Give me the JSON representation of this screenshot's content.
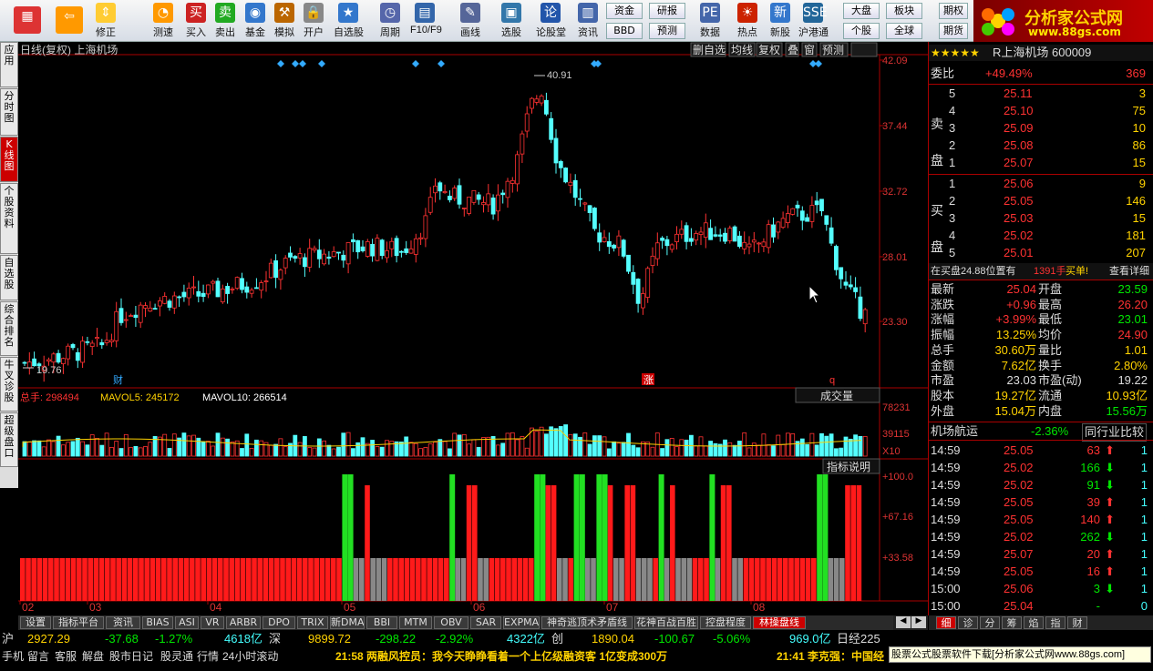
{
  "toolbar": {
    "buttons": [
      {
        "label": "",
        "icon": "windows-logo-icon"
      },
      {
        "label": "",
        "icon": "back-arrow-icon"
      },
      {
        "label": "修正",
        "icon": "up-down-arrow-icon"
      },
      {
        "label": "测速",
        "icon": "clock-icon"
      },
      {
        "label": "买入",
        "icon": "buy-icon"
      },
      {
        "label": "卖出",
        "icon": "sell-icon"
      },
      {
        "label": "基金",
        "icon": "fund-icon"
      },
      {
        "label": "模拟",
        "icon": "hammer-icon"
      },
      {
        "label": "开户",
        "icon": "lock-icon"
      },
      {
        "label": "自选股",
        "icon": "star-icon"
      },
      {
        "label": "周期",
        "icon": "clock-dropdown-icon"
      },
      {
        "label": "F10/F9",
        "icon": "doc-icon"
      },
      {
        "label": "画线",
        "icon": "pen-icon"
      },
      {
        "label": "选股",
        "icon": "screen-icon"
      },
      {
        "label": "论股堂",
        "icon": "forum-icon"
      },
      {
        "label": "资讯",
        "icon": "news-icon"
      },
      {
        "label": "数据",
        "icon": "pe-icon"
      },
      {
        "label": "热点",
        "icon": "hot-icon"
      },
      {
        "label": "新股",
        "icon": "ipo-icon"
      },
      {
        "label": "沪港通",
        "icon": "hk-icon"
      }
    ],
    "small": {
      "fund": "资金",
      "research": "研报",
      "bbd": "BBD",
      "forecast": "预测",
      "market": "大盘",
      "sector": "板块",
      "futures": "期权",
      "stock": "个股",
      "global": "全球",
      "fut": "期货"
    }
  },
  "logo": {
    "title": "分析家公式网",
    "url": "www.88gs.com"
  },
  "sidebar": {
    "tabs": [
      "应用",
      "分时图",
      "K线图",
      "个股资料",
      "自选股",
      "综合排名",
      "牛叉诊股",
      "超级盘口"
    ]
  },
  "chart": {
    "title": "日线(复权) 上海机场",
    "toolbar": [
      "删自选",
      "均线",
      "复权",
      "叠",
      "窗",
      "预测"
    ],
    "price_axis": [
      "42.09",
      "37.44",
      "32.72",
      "28.01",
      "23.30"
    ],
    "high_label": "40.91",
    "low_label": "19.76",
    "markers": [
      "财",
      "涨",
      "q"
    ],
    "vol_legend": {
      "total": "总手: 298494",
      "mavol5": "MAVOL5: 245172",
      "mavol10": "MAVOL10: 266514",
      "select": "成交量"
    },
    "vol_axis": [
      "78231",
      "39115",
      "X10"
    ],
    "ind_button": "指标说明",
    "ind_axis": [
      "+100.0",
      "+67.16",
      "+33.58"
    ],
    "months": [
      "02",
      "03",
      "04",
      "05",
      "06",
      "07",
      "08"
    ]
  },
  "chart_data": {
    "type": "candlestick",
    "high": 40.91,
    "low": 19.76,
    "y_range": [
      19.0,
      42.09
    ],
    "volume_max": 78231
  },
  "quote": {
    "title": "R上海机场 600009",
    "weibi": {
      "label": "委比",
      "value": "+49.49%",
      "diff": "369"
    },
    "sell_label": "卖盘",
    "buy_label": "买盘",
    "asks": [
      {
        "n": "5",
        "p": "25.11",
        "v": "3"
      },
      {
        "n": "4",
        "p": "25.10",
        "v": "75"
      },
      {
        "n": "3",
        "p": "25.09",
        "v": "10"
      },
      {
        "n": "2",
        "p": "25.08",
        "v": "86"
      },
      {
        "n": "1",
        "p": "25.07",
        "v": "15"
      }
    ],
    "bids": [
      {
        "n": "1",
        "p": "25.06",
        "v": "9"
      },
      {
        "n": "2",
        "p": "25.05",
        "v": "146"
      },
      {
        "n": "3",
        "p": "25.03",
        "v": "15"
      },
      {
        "n": "4",
        "p": "25.02",
        "v": "181"
      },
      {
        "n": "5",
        "p": "25.01",
        "v": "207"
      }
    ],
    "notice": {
      "a": "在买盘24.88位置有",
      "b": "1391手",
      "c": "买单!",
      "d": "查看详细"
    },
    "stats": [
      {
        "l": "最新",
        "v": "25.04",
        "l2": "开盘",
        "v2": "23.59"
      },
      {
        "l": "涨跌",
        "v": "+0.96",
        "l2": "最高",
        "v2": "26.20"
      },
      {
        "l": "涨幅",
        "v": "+3.99%",
        "l2": "最低",
        "v2": "23.01"
      },
      {
        "l": "振幅",
        "v": "13.25%",
        "l2": "均价",
        "v2": "24.90"
      },
      {
        "l": "总手",
        "v": "30.60万",
        "l2": "量比",
        "v2": "1.01"
      },
      {
        "l": "金额",
        "v": "7.62亿",
        "l2": "换手",
        "v2": "2.80%"
      },
      {
        "l": "市盈",
        "v": "23.03",
        "l2": "市盈(动)",
        "v2": "19.22"
      },
      {
        "l": "股本",
        "v": "19.27亿",
        "l2": "流通",
        "v2": "10.93亿"
      },
      {
        "l": "外盘",
        "v": "15.04万",
        "l2": "内盘",
        "v2": "15.56万"
      }
    ],
    "industry": {
      "name": "机场航运",
      "pct": "-2.36%",
      "compare": "同行业比较"
    },
    "ticks": [
      {
        "t": "14:59",
        "p": "25.05",
        "v": "63",
        "d": "up",
        "n": "1"
      },
      {
        "t": "14:59",
        "p": "25.02",
        "v": "166",
        "d": "down",
        "n": "1"
      },
      {
        "t": "14:59",
        "p": "25.02",
        "v": "91",
        "d": "down",
        "n": "1"
      },
      {
        "t": "14:59",
        "p": "25.05",
        "v": "39",
        "d": "up",
        "n": "1"
      },
      {
        "t": "14:59",
        "p": "25.05",
        "v": "140",
        "d": "up",
        "n": "1"
      },
      {
        "t": "14:59",
        "p": "25.02",
        "v": "262",
        "d": "down",
        "n": "1"
      },
      {
        "t": "14:59",
        "p": "25.07",
        "v": "20",
        "d": "up",
        "n": "1"
      },
      {
        "t": "14:59",
        "p": "25.05",
        "v": "16",
        "d": "up",
        "n": "1"
      },
      {
        "t": "15:00",
        "p": "25.06",
        "v": "3",
        "d": "down",
        "n": "1"
      },
      {
        "t": "15:00",
        "p": "25.04",
        "v": "-",
        "d": "none",
        "n": "0"
      }
    ],
    "bottom_tabs": [
      "细",
      "诊",
      "分",
      "筹",
      "焰",
      "指",
      "财"
    ]
  },
  "bottom_tabs": [
    "设置",
    "指标平台",
    "资讯",
    "BIAS",
    "ASI",
    "VR",
    "ARBR",
    "DPO",
    "TRIX",
    "新DMA",
    "BBI",
    "MTM",
    "OBV",
    "SAR",
    "EXPMA",
    "神奇逃顶术矛盾线",
    "花神百战百胜",
    "控盘程度",
    "林操盘线"
  ],
  "status1": {
    "sh": "沪",
    "sh_idx": "2927.29",
    "sh_chg": "-37.68",
    "sh_pct": "-1.27%",
    "sh_amt": "4618亿",
    "sz": "深",
    "sz_idx": "9899.72",
    "sz_chg": "-298.22",
    "sz_pct": "-2.92%",
    "sz_amt": "4322亿",
    "cy": "创",
    "cy_idx": "1890.04",
    "cy_chg": "-100.67",
    "cy_pct": "-5.06%",
    "cy_amt": "969.0亿",
    "rj": "日经225"
  },
  "status2": {
    "items": [
      "手机",
      "留言",
      "客服",
      "解盘",
      "股市日记",
      "股灵通",
      "行情",
      "24小时滚动"
    ],
    "news1": "21:58 两融风控员：我今天睁睁看着一个上亿级融资客 1亿变成300万",
    "news2": "21:41 李克强：中国经",
    "ad": "股票公式股票软件下载[分析家公式网www.88gs.com]"
  }
}
